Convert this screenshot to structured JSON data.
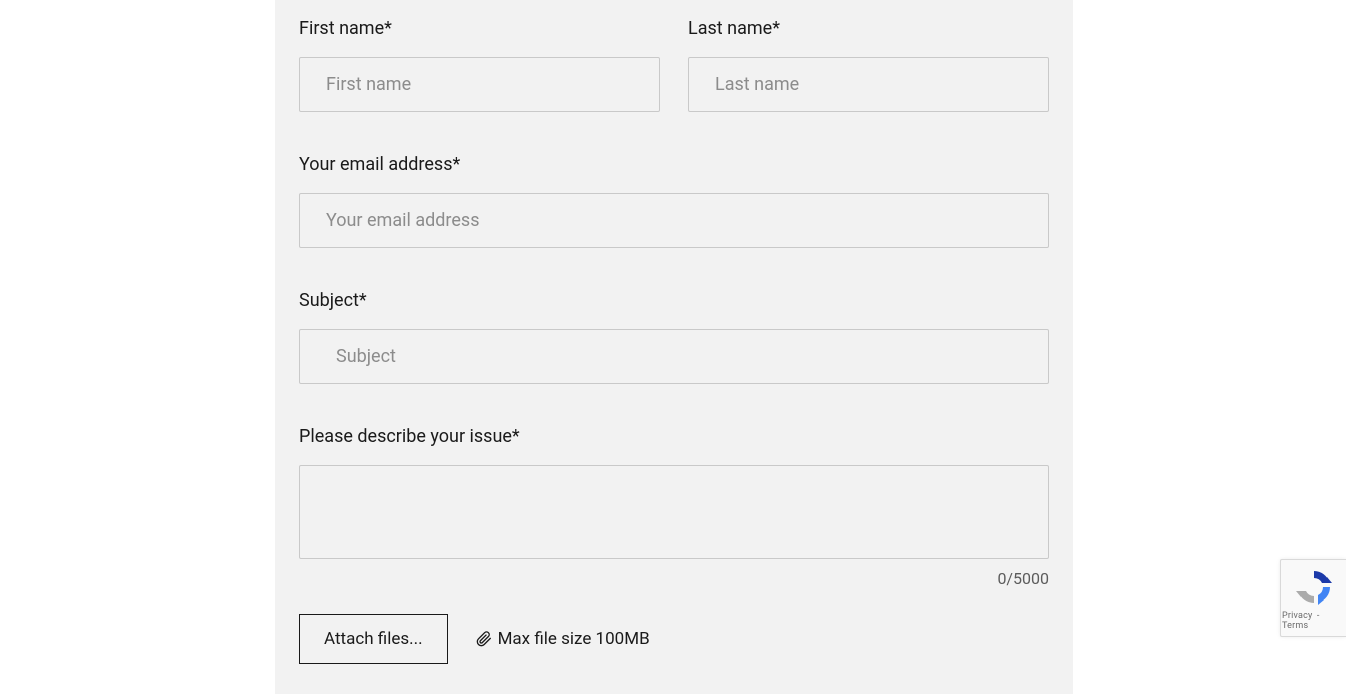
{
  "form": {
    "first_name": {
      "label": "First name*",
      "placeholder": "First name",
      "value": ""
    },
    "last_name": {
      "label": "Last name*",
      "placeholder": "Last name",
      "value": ""
    },
    "email": {
      "label": "Your email address*",
      "placeholder": "Your email address",
      "value": ""
    },
    "subject": {
      "label": "Subject*",
      "placeholder": "Subject",
      "value": ""
    },
    "issue": {
      "label": "Please describe your issue*",
      "placeholder": "",
      "value": ""
    },
    "char_counter": "0/5000",
    "attach_button": "Attach files...",
    "file_hint": "Max file size 100MB"
  },
  "recaptcha": {
    "privacy": "Privacy",
    "sep": " - ",
    "terms": "Terms"
  }
}
